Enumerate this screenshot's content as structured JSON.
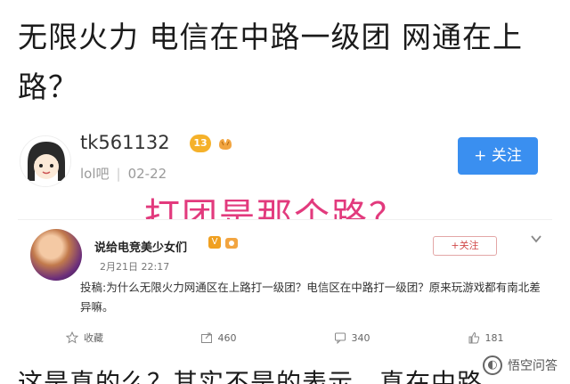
{
  "headline": "无限火力 电信在中路一级团 网通在上路？",
  "post": {
    "username": "tk561132",
    "level": "13",
    "source": "lol吧",
    "date": "02-22",
    "follow_label": "+ 关注"
  },
  "overlay_question": "打团是那个路？",
  "embedded_post": {
    "author": "说给电竞美少女们",
    "date_time": "2月21日 22:17",
    "follow_label": "+关注",
    "text": "投稿:为什么无限火力网通区在上路打一级团？电信区在中路打一级团？原来玩游戏都有南北差异嘛。",
    "actions": {
      "favorite_label": "收藏",
      "repost_count": "460",
      "comment_count": "340",
      "like_count": "181"
    }
  },
  "bottom_text": "这是真的么？其实不是的表示，真在中路",
  "watermark": "悟空问答"
}
